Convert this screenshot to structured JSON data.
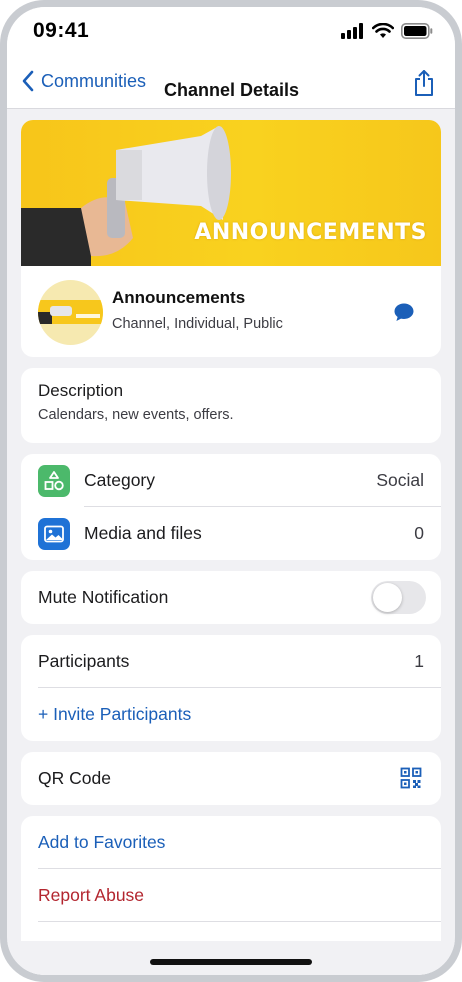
{
  "status_bar": {
    "time": "09:41"
  },
  "nav": {
    "back_label": "Communities",
    "title": "Channel Details"
  },
  "banner": {
    "text": "ANNOUNCEMENTS"
  },
  "channel": {
    "name": "Announcements",
    "subtitle": "Channel, Individual, Public"
  },
  "description": {
    "label": "Description",
    "text": "Calendars, new events, offers."
  },
  "category": {
    "label": "Category",
    "value": "Social"
  },
  "media": {
    "label": "Media and files",
    "value": "0"
  },
  "mute": {
    "label": "Mute Notification",
    "enabled": false
  },
  "participants": {
    "label": "Participants",
    "count": "1",
    "invite_label": "+ Invite Participants"
  },
  "qr": {
    "label": "QR Code"
  },
  "actions": {
    "favorites_label": "Add to Favorites",
    "report_label": "Report Abuse"
  },
  "colors": {
    "accent": "#1b5fb8",
    "danger": "#b3262f",
    "category_icon_bg": "#4cb96b",
    "media_icon_bg": "#1f72d6",
    "banner_bg": "#f9d21f"
  },
  "icons": {
    "back": "chevron-left-icon",
    "share": "share-icon",
    "chat": "chat-bubble-icon",
    "category": "shapes-icon",
    "media": "image-icon",
    "qr": "qr-code-icon",
    "signal": "signal-icon",
    "wifi": "wifi-icon",
    "battery": "battery-icon"
  }
}
